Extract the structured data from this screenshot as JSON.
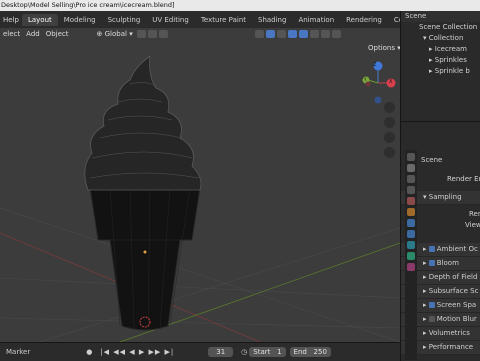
{
  "titlebar": {
    "text": "Desktop\\Model Selling\\Pro ice cream\\icecream.blend]"
  },
  "menubar": {
    "items": [
      "Help"
    ],
    "workspaces": [
      "Layout",
      "Modeling",
      "Sculpting",
      "UV Editing",
      "Texture Paint",
      "Shading",
      "Animation",
      "Rendering",
      "Compositin"
    ]
  },
  "viewport_header": {
    "select": "elect",
    "add": "Add",
    "object": "Object",
    "orientation": "Global",
    "options": "Options"
  },
  "gizmo": {
    "z": "Z",
    "x": "X",
    "y": "Y"
  },
  "outliner": {
    "header": "Scene",
    "rows": [
      "Scene Collection",
      "Collection",
      "Icecream",
      "Sprinkles",
      "Sprinkle b"
    ]
  },
  "properties": {
    "scene_label": "Scene",
    "render_engine": "Render Eng",
    "sampling": "Sampling",
    "render_short": "Ren",
    "viewport_short": "View",
    "ambient_occlusion": "Ambient Oc",
    "bloom": "Bloom",
    "depth_of_field": "Depth of Field",
    "subsurface": "Subsurface Sc",
    "screen_space": "Screen Spa",
    "motion_blur": "Motion Blur",
    "volumetrics": "Volumetrics",
    "performance": "Performance"
  },
  "timeline": {
    "marker": "Marker",
    "current_frame": "31",
    "start_label": "Start",
    "start_value": "1",
    "end_label": "End",
    "end_value": "250"
  }
}
